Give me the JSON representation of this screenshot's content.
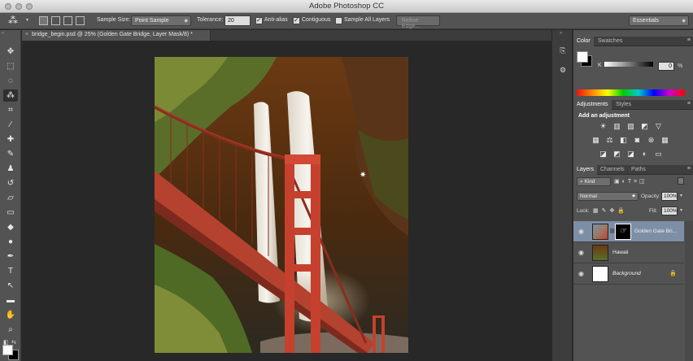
{
  "app": {
    "title": "Adobe Photoshop CC"
  },
  "options_bar": {
    "sample_size_label": "Sample Size:",
    "sample_size_value": "Point Sample",
    "tolerance_label": "Tolerance:",
    "tolerance_value": "20",
    "anti_alias_label": "Anti-alias",
    "anti_alias_checked": true,
    "contiguous_label": "Contiguous",
    "contiguous_checked": true,
    "sample_all_layers_label": "Sample All Layers",
    "sample_all_layers_checked": false,
    "refine_edge_label": "Refine Edge...",
    "workspace_value": "Essentials"
  },
  "document": {
    "tab_label": "bridge_begin.psd @ 25% (Golden Gate Bridge, Layer Mask/8) *",
    "close_glyph": "×"
  },
  "panels": {
    "color": {
      "tabs": [
        "Color",
        "Swatches"
      ],
      "slider_label": "K",
      "value": "0",
      "unit": "%"
    },
    "adjustments": {
      "tabs": [
        "Adjustments",
        "Styles"
      ],
      "heading": "Add an adjustment"
    },
    "layers": {
      "tabs": [
        "Layers",
        "Channels",
        "Paths"
      ],
      "filter_kind": "Kind",
      "blend_mode": "Normal",
      "opacity_label": "Opacity:",
      "opacity_value": "100%",
      "lock_label": "Lock:",
      "fill_label": "Fill:",
      "fill_value": "100%",
      "items": [
        {
          "name": "Golden Gate Bri...",
          "selected": true,
          "has_mask": true
        },
        {
          "name": "Hawaii",
          "selected": false
        },
        {
          "name": "Background",
          "selected": false,
          "locked": true
        }
      ]
    }
  },
  "colors": {
    "accent_selection": "#7d8fa6",
    "bridge_red": "#c6402e"
  }
}
